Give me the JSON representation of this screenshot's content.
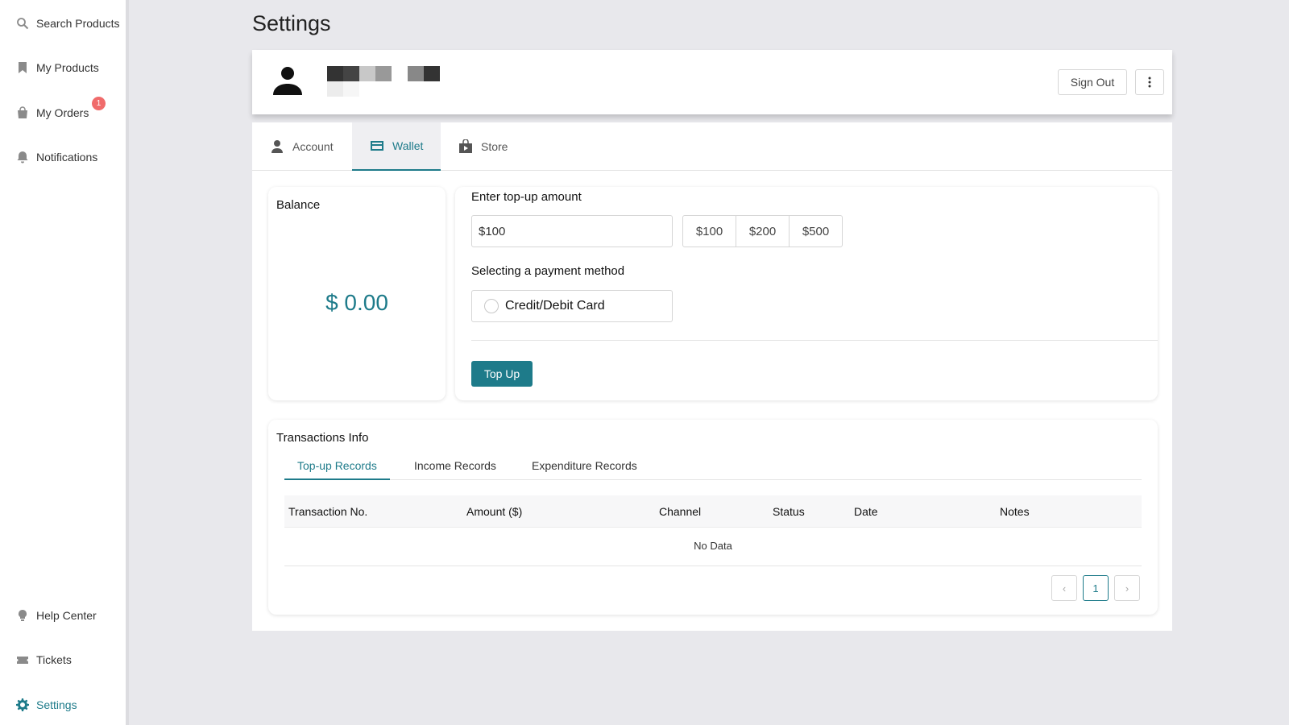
{
  "sidebar": {
    "top_items": [
      {
        "label": "Search Products",
        "icon": "search-icon"
      },
      {
        "label": "My Products",
        "icon": "bookmark-icon"
      },
      {
        "label": "My Orders",
        "icon": "shopping-bag-icon",
        "badge": "1"
      },
      {
        "label": "Notifications",
        "icon": "bell-icon"
      }
    ],
    "bottom_items": [
      {
        "label": "Help Center",
        "icon": "lightbulb-icon"
      },
      {
        "label": "Tickets",
        "icon": "ticket-icon"
      },
      {
        "label": "Settings",
        "icon": "gear-icon",
        "active": true
      }
    ]
  },
  "page": {
    "title": "Settings"
  },
  "profile": {
    "sign_out_label": "Sign Out",
    "more_icon": "more-vertical-icon"
  },
  "tabs": [
    {
      "label": "Account",
      "icon": "user-icon"
    },
    {
      "label": "Wallet",
      "icon": "credit-card-icon",
      "active": true
    },
    {
      "label": "Store",
      "icon": "store-icon"
    }
  ],
  "wallet": {
    "balance_label": "Balance",
    "balance_value": "$ 0.00",
    "topup_label": "Enter top-up amount",
    "amount_value": "$100",
    "presets": [
      "$100",
      "$200",
      "$500"
    ],
    "payment_label": "Selecting a payment method",
    "payment_option": "Credit/Debit Card",
    "topup_button": "Top Up"
  },
  "transactions": {
    "title": "Transactions Info",
    "tabs": [
      "Top-up Records",
      "Income Records",
      "Expenditure Records"
    ],
    "columns": [
      "Transaction No.",
      "Amount ($)",
      "Channel",
      "Status",
      "Date",
      "Notes"
    ],
    "empty_text": "No Data",
    "pagination": {
      "prev": "‹",
      "current": "1",
      "next": "›"
    }
  },
  "colors": {
    "accent": "#1e7b8a",
    "badge": "#f06b6b",
    "background": "#e8e8ec"
  }
}
